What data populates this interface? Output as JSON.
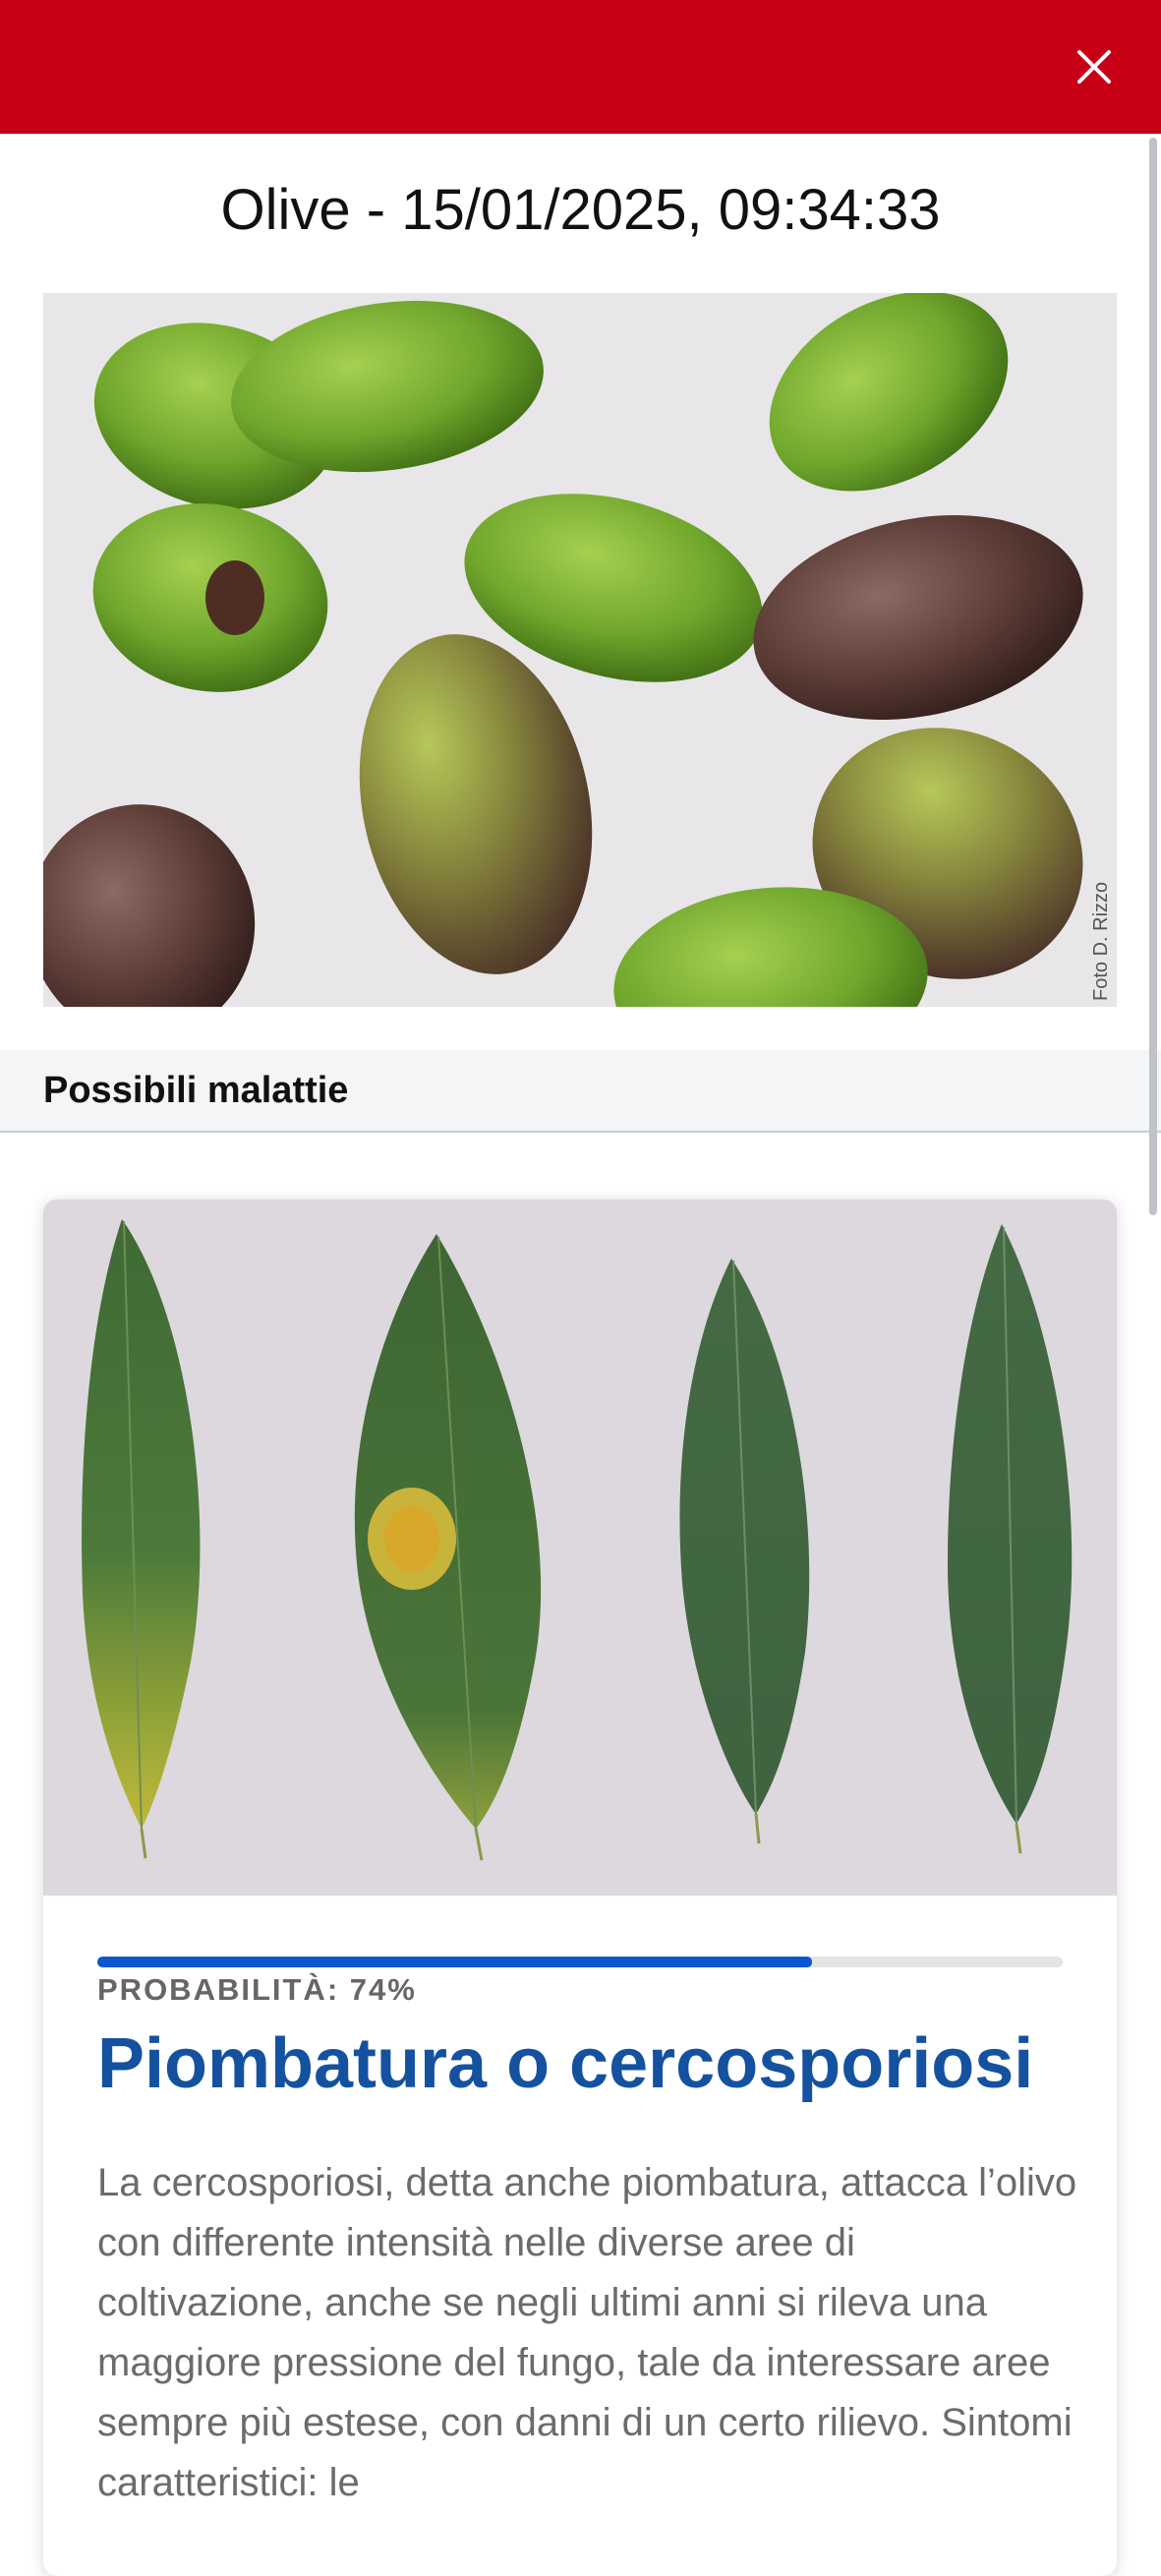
{
  "header": {
    "background_color": "#c70015",
    "close_icon": "close-icon"
  },
  "report": {
    "title": "Olive - 15/01/2025, 09:34:33",
    "photo_credit": "Foto D. Rizzo"
  },
  "section": {
    "title": "Possibili malattie"
  },
  "disease_card": {
    "probability_label": "PROBABILITÀ: 74%",
    "probability_value": 74,
    "probability_color": "#0b57d0",
    "name": "Piombatura o cercosporiosi",
    "name_color": "#1452a0",
    "description": "La cercosporiosi, detta anche piombatura, attacca l’olivo con differente intensità nelle diverse aree di coltivazione, anche se negli ultimi anni si rileva una maggiore pressione del fungo, tale da interessare aree sempre più estese, con danni di un certo rilievo.  Sintomi caratteristici: le"
  }
}
